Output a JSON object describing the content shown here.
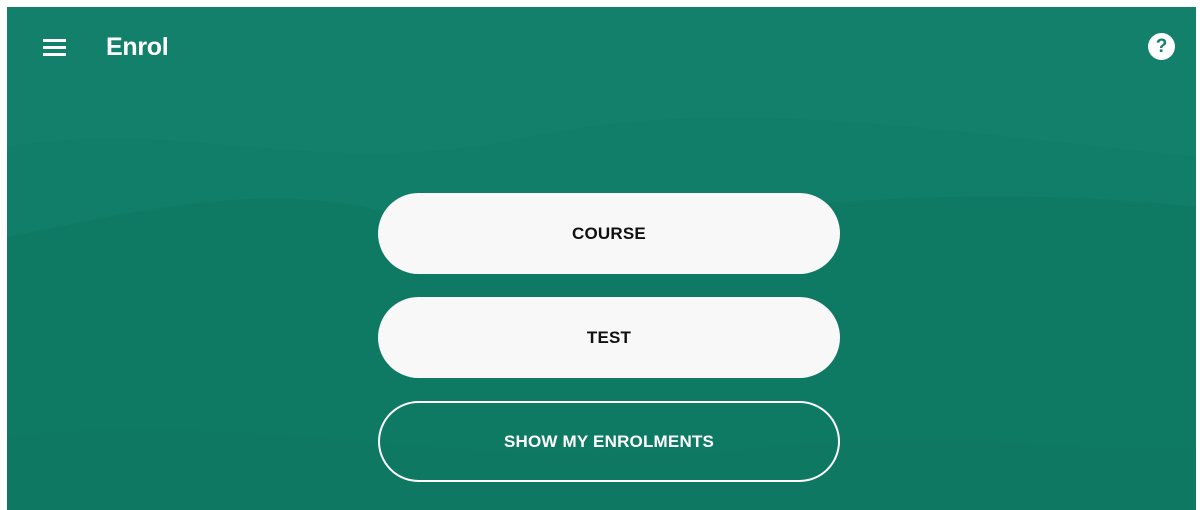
{
  "app": {
    "title": "Enrol",
    "menu_icon": "hamburger-menu-icon",
    "help_icon": "help-question-icon",
    "help_glyph": "?"
  },
  "colors": {
    "background": "#12806a",
    "button_fill": "#f8f8f8",
    "button_text": "#111111",
    "outline": "#ffffff"
  },
  "actions": {
    "course_label": "COURSE",
    "test_label": "TEST",
    "show_enrolments_label": "SHOW MY ENROLMENTS"
  }
}
